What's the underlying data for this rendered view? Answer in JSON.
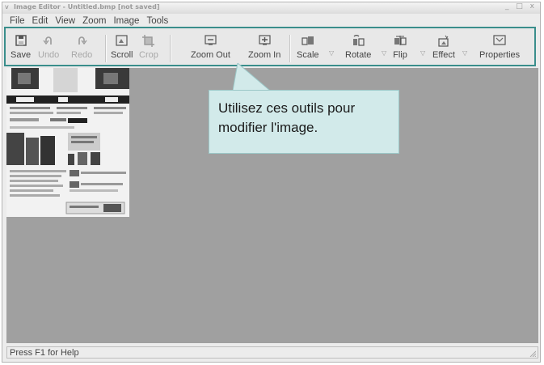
{
  "window": {
    "title": "Image Editor - Untitled.bmp [not saved]",
    "system_menu_glyph": "v",
    "controls": "_ □ x"
  },
  "menubar": {
    "items": [
      "File",
      "Edit",
      "View",
      "Zoom",
      "Image",
      "Tools"
    ]
  },
  "toolbar": {
    "save": "Save",
    "undo": "Undo",
    "redo": "Redo",
    "scroll": "Scroll",
    "crop": "Crop",
    "zoom_out": "Zoom Out",
    "zoom_in": "Zoom In",
    "scale": "Scale",
    "rotate": "Rotate",
    "flip": "Flip",
    "effect": "Effect",
    "properties": "Properties"
  },
  "callout": {
    "line1": "Utilisez ces outils pour",
    "line2": "modifier l'image."
  },
  "status": {
    "text": "Press F1 for Help"
  },
  "colors": {
    "highlight_border": "#3a8e8c",
    "callout_bg": "#d2eaea",
    "canvas_bg": "#a0a0a0"
  }
}
